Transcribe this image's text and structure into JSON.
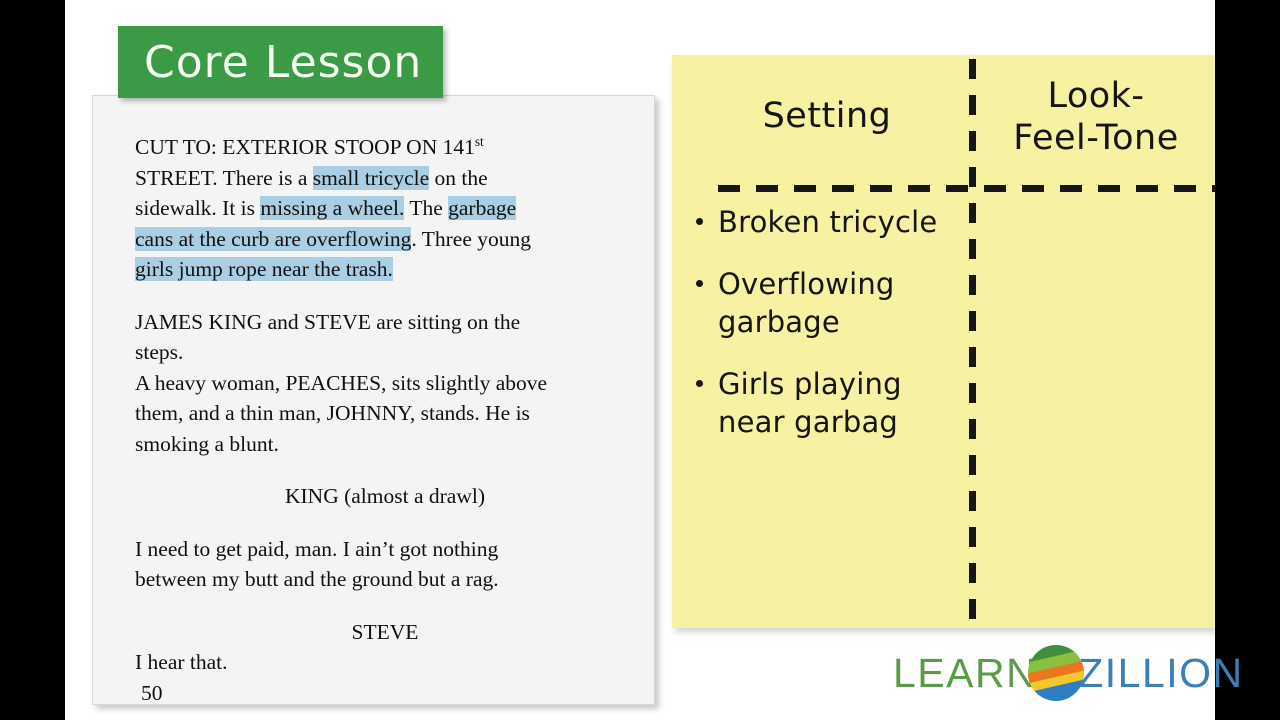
{
  "slide": {
    "title": "Core Lesson",
    "banner_color": "#3a9a45",
    "highlight_color": "#aacfe4",
    "chart_color": "#f7f1a2"
  },
  "document": {
    "line1_pre": "CUT TO:  EXTERIOR STOOP ON 141",
    "line1_sup": "st",
    "line2_pre": "STREET.  There is a ",
    "hl_small_tricycle": "small tricycle",
    "line2_post": " on the",
    "line3_pre": "sidewalk.  It is ",
    "hl_missing_wheel": "missing a wheel.",
    "line3_mid": "  The ",
    "hl_garbage": "garbage",
    "hl_cans_line": "cans at the curb are overflowing",
    "line4_post": ".  Three young",
    "hl_girls_line": "girls jump rope near the trash.",
    "para2_line1": "JAMES KING and STEVE are sitting on the",
    "para2_line2": "steps.",
    "para3_line1": "A heavy woman, PEACHES, sits slightly above",
    "para3_line2": "them, and a thin man, JOHNNY, stands.  He is",
    "para3_line3": "smoking a blunt.",
    "speaker_king": "KING (almost a drawl)",
    "king_line1": "I need to get paid, man.  I ain’t got nothing",
    "king_line2": "between my butt and the ground but a rag.",
    "speaker_steve": "STEVE",
    "steve_line": "I hear that.",
    "page_number": "50"
  },
  "chart": {
    "columns": [
      {
        "label": "Setting"
      },
      {
        "label": "Look-\nFeel-Tone",
        "line1": "Look-",
        "line2": "Feel-Tone"
      }
    ],
    "setting_bullets": [
      {
        "text": "Broken tricycle"
      },
      {
        "text": "Overflowing garbage"
      },
      {
        "text": "Girls playing near garbag"
      }
    ],
    "lookfeel_bullets": []
  },
  "logo": {
    "word_learn": "LEARN",
    "word_zillion": "ZILLION",
    "learn_color": "#5b9a4a",
    "zillion_color": "#3b7fb5"
  }
}
